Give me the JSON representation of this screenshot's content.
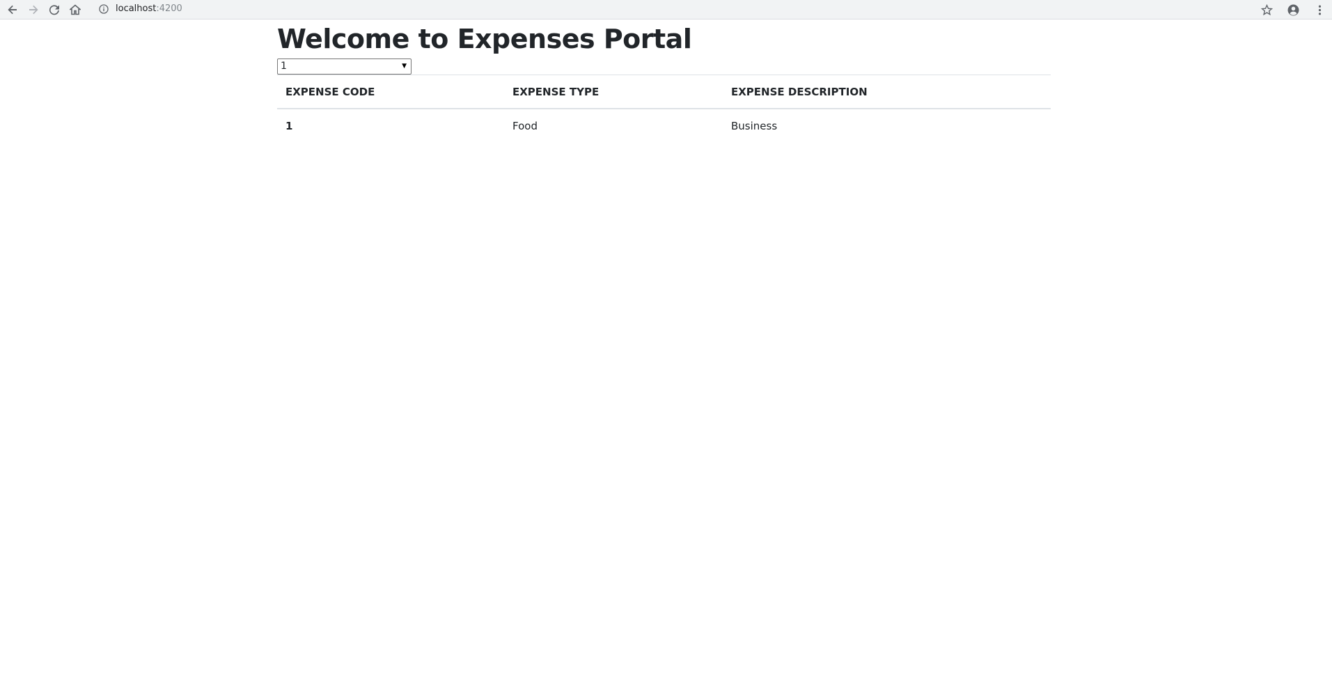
{
  "browser": {
    "url_host": "localhost",
    "url_port": ":4200",
    "icons": [
      "back-icon",
      "forward-icon",
      "reload-icon",
      "home-icon",
      "info-icon",
      "star-icon",
      "account-icon",
      "menu-icon"
    ]
  },
  "page": {
    "title": "Welcome to Expenses Portal"
  },
  "select": {
    "selected_value": "1"
  },
  "table": {
    "headers": [
      "EXPENSE CODE",
      "EXPENSE TYPE",
      "EXPENSE DESCRIPTION"
    ],
    "rows": [
      {
        "code": "1",
        "type": "Food",
        "description": "Business"
      }
    ]
  },
  "colors": {
    "text": "#212529",
    "border": "#dee2e6",
    "toolbar": "#f1f3f4"
  }
}
